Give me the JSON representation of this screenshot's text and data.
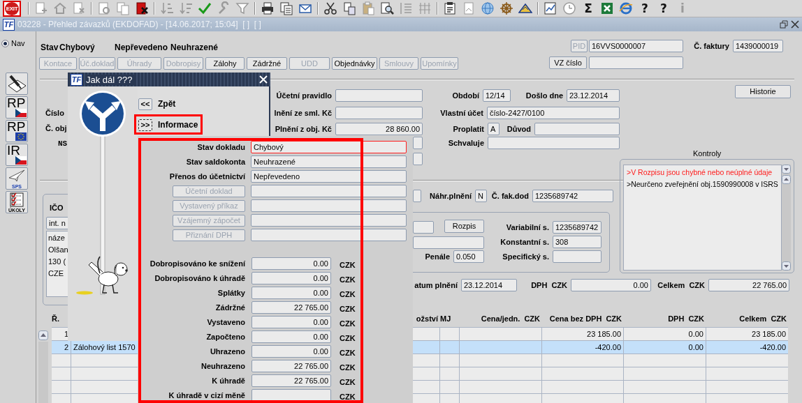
{
  "toolbar": [
    {
      "kind": "exit",
      "text": "EXIT",
      "disabled": false
    },
    {
      "kind": "separator"
    },
    {
      "kind": "record-add",
      "disabled": true
    },
    {
      "kind": "home",
      "disabled": true
    },
    {
      "kind": "record-delete",
      "disabled": true
    },
    {
      "kind": "separator"
    },
    {
      "kind": "query",
      "disabled": true
    },
    {
      "kind": "copy-doc",
      "disabled": true
    },
    {
      "kind": "doc-delete",
      "disabled": false
    },
    {
      "kind": "separator"
    },
    {
      "kind": "sort-asc",
      "disabled": true
    },
    {
      "kind": "sort-desc",
      "disabled": true
    },
    {
      "kind": "check",
      "disabled": false
    },
    {
      "kind": "wrench",
      "disabled": true
    },
    {
      "kind": "filter",
      "disabled": true
    },
    {
      "kind": "separator"
    },
    {
      "kind": "printer",
      "disabled": false
    },
    {
      "kind": "documents",
      "disabled": false
    },
    {
      "kind": "mail",
      "disabled": false
    },
    {
      "kind": "separator"
    },
    {
      "kind": "scissors",
      "disabled": false
    },
    {
      "kind": "copy",
      "disabled": false
    },
    {
      "kind": "paste",
      "disabled": true
    },
    {
      "kind": "search-doc",
      "disabled": false
    },
    {
      "kind": "list",
      "disabled": true
    },
    {
      "kind": "columns",
      "disabled": true
    },
    {
      "kind": "separator"
    },
    {
      "kind": "clipboard",
      "disabled": false
    },
    {
      "kind": "page",
      "disabled": true
    },
    {
      "kind": "globe",
      "disabled": false
    },
    {
      "kind": "wheel",
      "disabled": false
    },
    {
      "kind": "mountain",
      "disabled": false
    },
    {
      "kind": "separator"
    },
    {
      "kind": "chart",
      "disabled": false
    },
    {
      "kind": "clock",
      "disabled": true
    },
    {
      "kind": "sum",
      "text": "Σ",
      "disabled": false
    },
    {
      "kind": "spreadsheet",
      "disabled": false
    },
    {
      "kind": "browser",
      "disabled": false
    },
    {
      "kind": "help",
      "text": "?",
      "disabled": false
    },
    {
      "kind": "help",
      "text": "?",
      "disabled": false
    },
    {
      "kind": "info",
      "text": "i",
      "disabled": true
    }
  ],
  "window": {
    "logo": "TF",
    "title": "03228 - Přehled závazků (EKDOFAD) - [14.06.2017; 15:04]  [ ]  [ ]"
  },
  "nav": {
    "label": "Nav",
    "selected": true
  },
  "side_tools": [
    {
      "kind": "pen-paper"
    },
    {
      "kind": "rp-cz",
      "text": "RP"
    },
    {
      "kind": "rp-eu",
      "text": "RP"
    },
    {
      "kind": "ir-cz",
      "text": "IR"
    },
    {
      "kind": "sps",
      "text": "SPS"
    },
    {
      "kind": "tasks",
      "text": "ÚKOLY"
    }
  ],
  "status": {
    "label": "Stav",
    "value": "Chybový",
    "transfer": "Nepřevedeno",
    "payment": "Neuhrazené"
  },
  "tabs": [
    {
      "label": "Kontace",
      "disabled": true
    },
    {
      "label": "Úč.doklad",
      "disabled": true
    },
    {
      "label": "Úhrady",
      "disabled": true
    },
    {
      "label": "Dobropisy",
      "disabled": true
    },
    {
      "label": "Zálohy",
      "disabled": false
    },
    {
      "label": "Zádržné",
      "disabled": false
    },
    {
      "label": "UDD",
      "disabled": true
    },
    {
      "label": "Objednávky",
      "disabled": false
    },
    {
      "label": "Smlouvy",
      "disabled": true
    },
    {
      "label": "Upomínky",
      "disabled": true
    }
  ],
  "pid": {
    "label": "PID",
    "value": "16VVS0000007"
  },
  "invoice_number": {
    "label": "Č. faktury",
    "value": "1439000019"
  },
  "vz_button": "VZ číslo",
  "history_button": "Historie",
  "left_labels": [
    "Číslo",
    "Č. obj",
    "NS",
    "IČO"
  ],
  "form": [
    {
      "label": "Účetní pravidlo"
    },
    {
      "label": "lnění ze sml. Kč"
    },
    {
      "label": "Plnění z obj. Kč",
      "value": "28 860.00"
    },
    {
      "label": "Období",
      "value": "12/14"
    },
    {
      "label": "Došlo dne",
      "value": "23.12.2014"
    },
    {
      "label": "Vlastní účet",
      "value": "číslo-2427/0100"
    },
    {
      "label": "Proplatit",
      "value": "A"
    },
    {
      "label": "Důvod"
    },
    {
      "label": "Schvaluje"
    },
    {
      "label": "Náhr.plnění",
      "value": "N"
    },
    {
      "label": "Č. fak.dod",
      "value": "1235689742"
    },
    {
      "label": "Penále",
      "value": "0.050"
    },
    {
      "label": "Variabilní s.",
      "value": "1235689742"
    },
    {
      "label": "Konstantní s.",
      "value": "308"
    },
    {
      "label": "Specifický s."
    },
    {
      "label": "atum plnění",
      "value": "23.12.2014"
    },
    {
      "label": "DPH",
      "unit": "CZK",
      "value": "0.00"
    },
    {
      "label": "Celkem",
      "unit": "CZK",
      "value": "22 765.00"
    },
    {
      "value": "int. n"
    }
  ],
  "address": [
    "náze",
    "Olšan",
    "130 (",
    "CZE"
  ],
  "rozpis_button": "Rozpis",
  "checks": {
    "title": "Kontroly",
    "items": [
      {
        "text": ">V Rozpisu jsou chybné nebo neúplné údaje",
        "error": true
      },
      {
        "text": ">Neurčeno zveřejnění obj.1590990008 v ISRS",
        "error": false
      }
    ]
  },
  "table": {
    "columns": [
      {
        "label": "Ř."
      },
      {
        "label": "ožství"
      },
      {
        "label": "MJ"
      },
      {
        "label": "Cena/jedn.",
        "unit": "CZK"
      },
      {
        "label": "Cena bez DPH",
        "unit": "CZK"
      },
      {
        "label": "DPH",
        "unit": "CZK"
      },
      {
        "label": "Celkem",
        "unit": "CZK"
      }
    ],
    "rows": [
      {
        "number": "1",
        "price_net": "23 185.00",
        "vat": "0.00",
        "total": "23 185.00",
        "selected": false
      },
      {
        "number": "2",
        "description": "Zálohový list 1570",
        "price_net": "-420.00",
        "vat": "0.00",
        "total": "-420.00",
        "selected": true
      },
      {
        "selected": false
      },
      {
        "selected": false
      },
      {
        "selected": false
      },
      {
        "selected": false
      }
    ]
  },
  "dialog": {
    "logo": "TF",
    "title": "Jak dál ???",
    "back": {
      "symbol": "<<",
      "label": "Zpět"
    },
    "info": {
      "symbol": ">>",
      "label": "Informace"
    },
    "status_rows": [
      {
        "label": "Stav dokladu",
        "value": "Chybový",
        "error": true
      },
      {
        "label": "Stav saldokonta",
        "value": "Neuhrazené",
        "error": false
      },
      {
        "label": "Přenos do účetnictví",
        "value": "Nepřevedeno",
        "error": false
      }
    ],
    "link_buttons": [
      {
        "label": "Účetní doklad",
        "disabled": true
      },
      {
        "label": "Vystavený příkaz",
        "disabled": true
      },
      {
        "label": "Vzájemný zápočet",
        "disabled": true
      },
      {
        "label": "Přiznání DPH",
        "disabled": true
      }
    ],
    "amounts": [
      {
        "label": "Dobropisováno ke snížení",
        "value": "0.00",
        "currency": "CZK"
      },
      {
        "label": "Dobropisováno k úhradě",
        "value": "0.00",
        "currency": "CZK"
      },
      {
        "label": "Splátky",
        "value": "0.00",
        "currency": "CZK"
      },
      {
        "label": "Zádržné",
        "value": "22 765.00",
        "currency": "CZK"
      },
      {
        "label": "Vystaveno",
        "value": "0.00",
        "currency": "CZK"
      },
      {
        "label": "Započteno",
        "value": "0.00",
        "currency": "CZK"
      },
      {
        "label": "Uhrazeno",
        "value": "0.00",
        "currency": "CZK"
      },
      {
        "label": "Neuhrazeno",
        "value": "22 765.00",
        "currency": "CZK"
      },
      {
        "label": "K úhradě",
        "value": "22 765.00",
        "currency": "CZK"
      },
      {
        "label": "K úhradě v cizí měně",
        "currency": "CZK"
      }
    ]
  }
}
